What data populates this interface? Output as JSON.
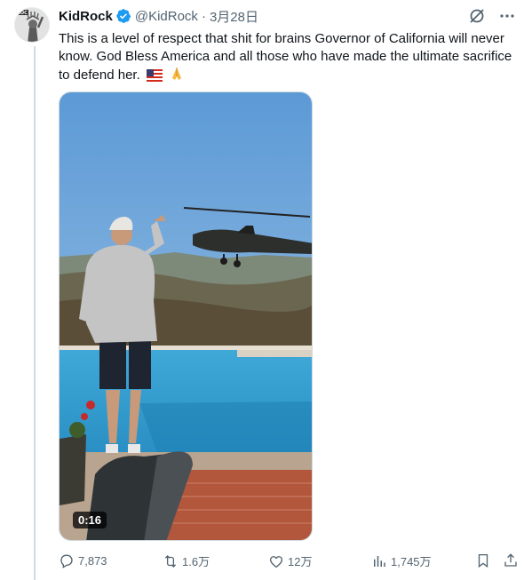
{
  "author": {
    "display_name": "KidRock",
    "handle": "@KidRock",
    "separator": "·",
    "date": "3月28日",
    "avatar_text": "ROC"
  },
  "tweet": {
    "text": "This is a level of respect that shit for brains Governor of California will never know. God Bless America and all those who have made the ultimate sacrifice to defend her.",
    "emojis": [
      "us-flag-icon",
      "folded-hands-icon"
    ]
  },
  "media": {
    "video_duration": "0:16"
  },
  "actions": {
    "replies": "7,873",
    "reposts": "1.6万",
    "likes": "12万",
    "views": "1,745万"
  },
  "colors": {
    "text_primary": "#0f1419",
    "text_secondary": "#536471",
    "verified_blue": "#1d9bf0",
    "divider": "#cfd9de"
  }
}
